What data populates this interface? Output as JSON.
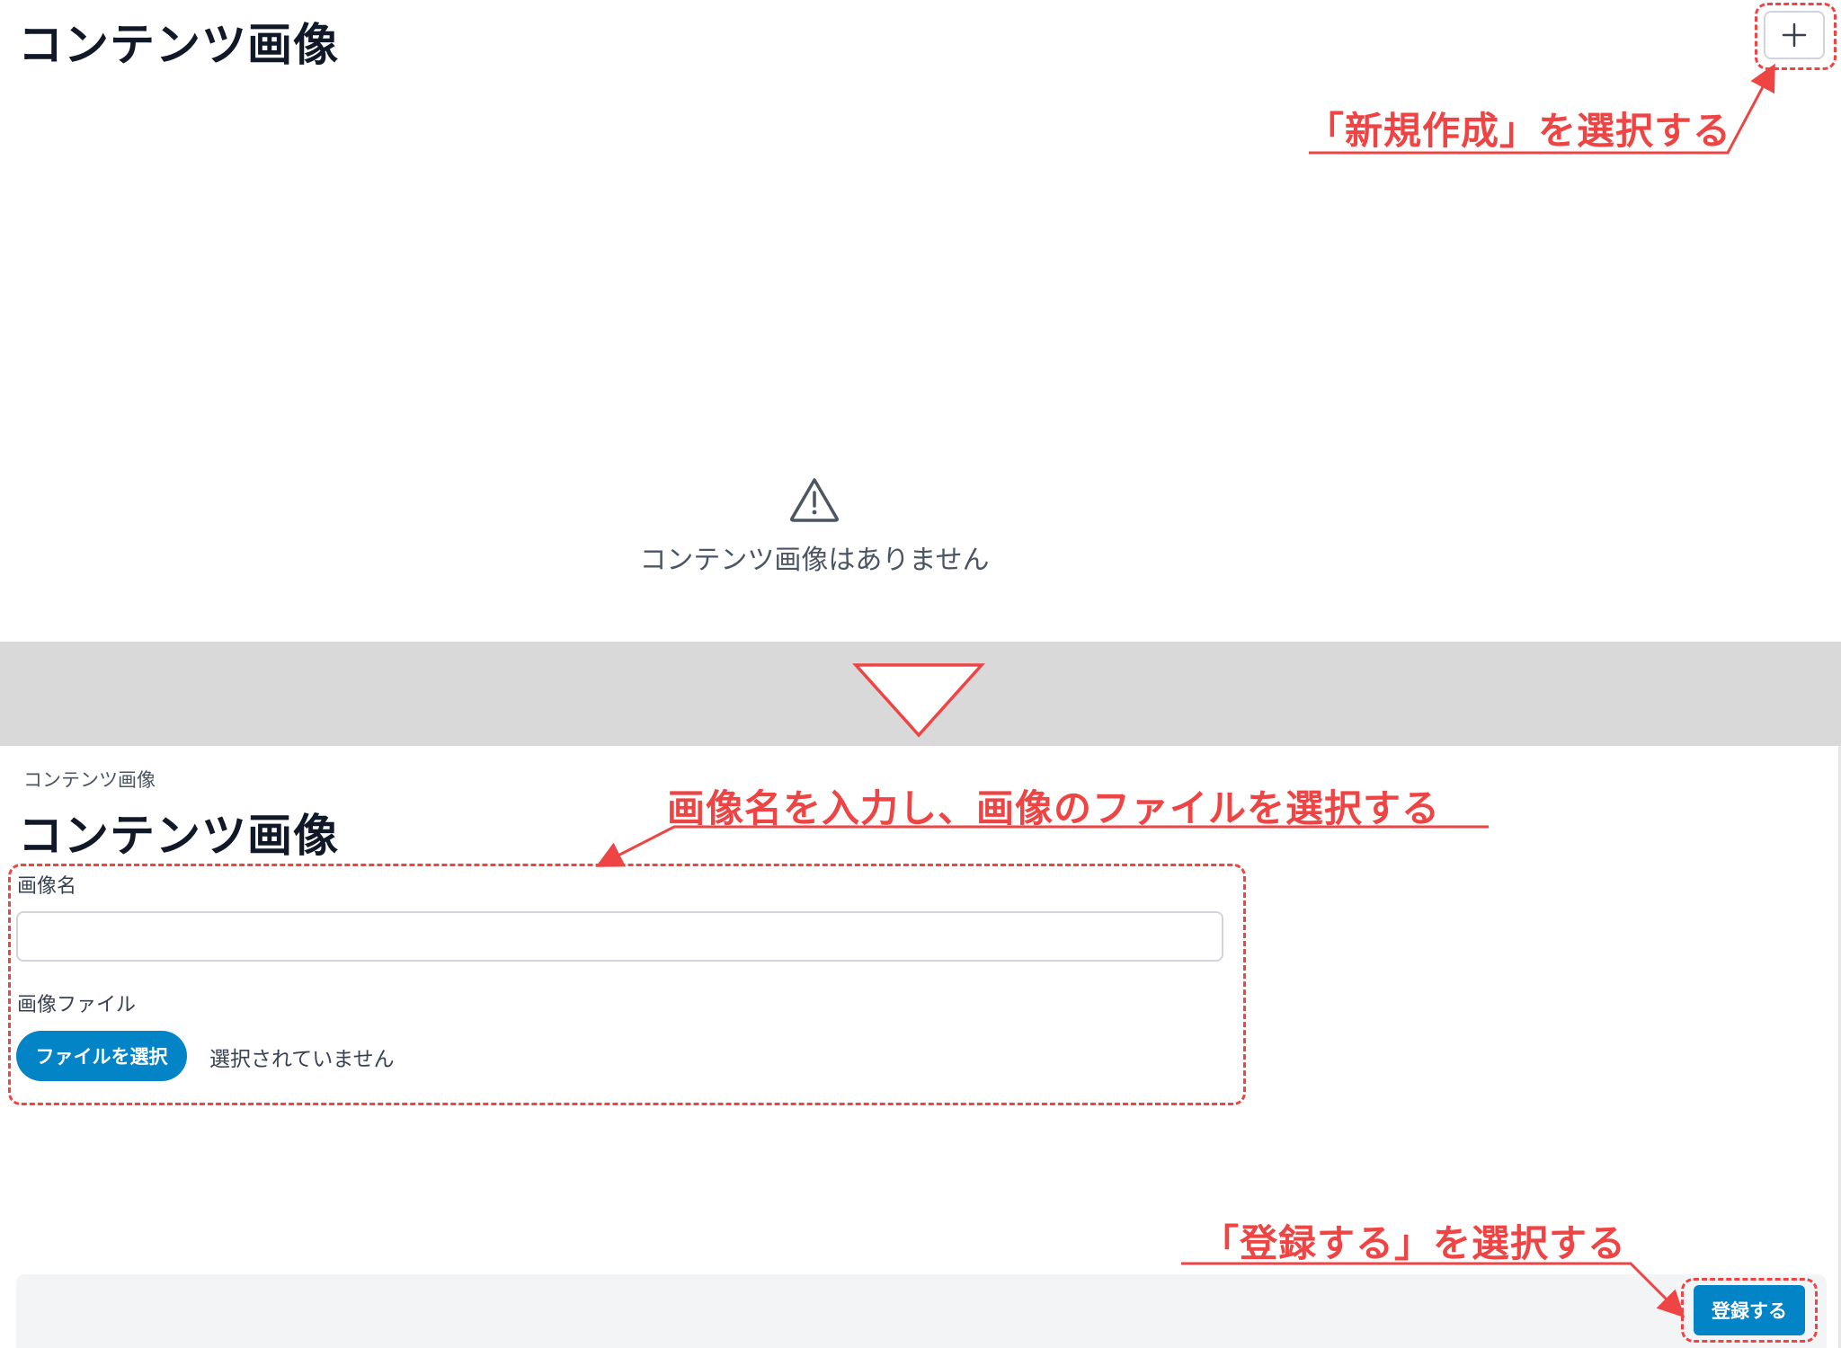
{
  "top_screen": {
    "title": "コンテンツ画像",
    "add_button_icon": "plus-icon",
    "empty_state": {
      "icon": "warning-icon",
      "message": "コンテンツ画像はありません"
    }
  },
  "bottom_screen": {
    "breadcrumb": "コンテンツ画像",
    "title": "コンテンツ画像",
    "name_field": {
      "label": "画像名",
      "value": "",
      "placeholder": ""
    },
    "file_field": {
      "label": "画像ファイル",
      "button_label": "ファイルを選択",
      "status": "選択されていません"
    },
    "submit_label": "登録する"
  },
  "annotations": {
    "new_create": "「新規作成」を選択する",
    "input_instruction": "画像名を入力し、画像のファイルを選択する",
    "register_instruction": "「登録する」を選択する"
  },
  "colors": {
    "annotation_red": "#ef4444",
    "primary_blue": "#0284c7",
    "divider_gray": "#d9d9d9",
    "title_text": "#111827"
  }
}
